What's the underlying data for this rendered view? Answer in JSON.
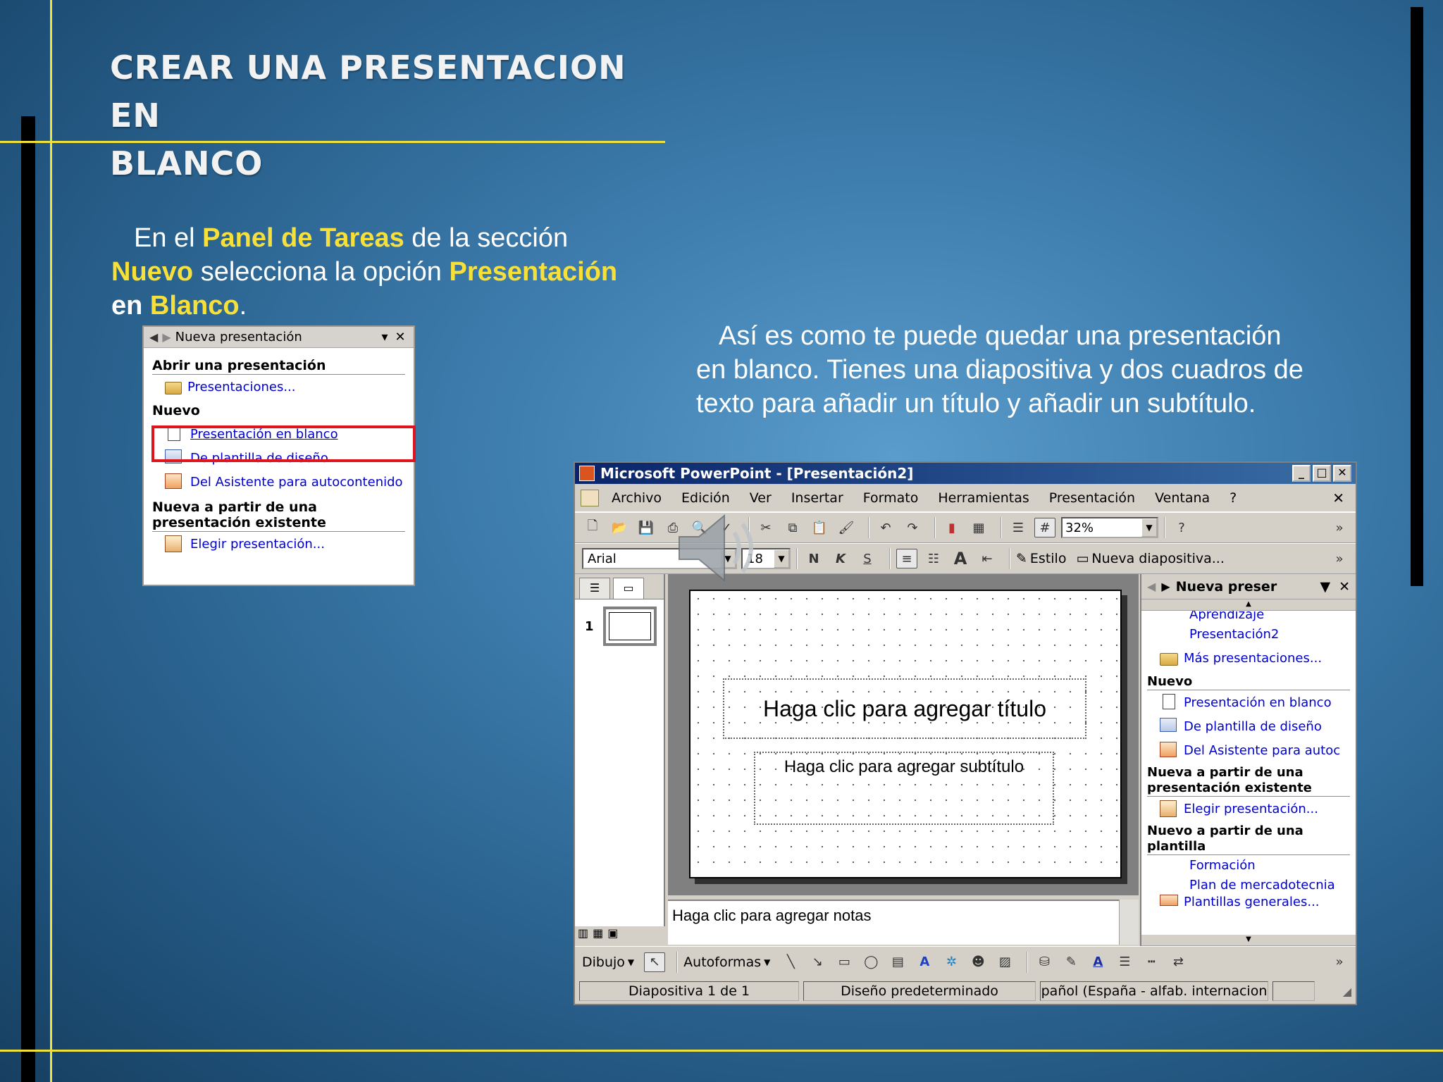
{
  "slide": {
    "title_line1": "CREAR UNA  PRESENTACION EN",
    "title_line2": "BLANCO",
    "instruction": {
      "p1": "En el ",
      "h1": "Panel de Tareas",
      "p2": " de la sección",
      "h2": "Nuevo",
      "p3": " selecciona la opción ",
      "h3": "Presentación",
      "p4": "en ",
      "h4": "Blanco",
      "p5": "."
    },
    "description_line1": "Así es como te puede quedar una presentación",
    "description_line2": "en blanco. Tienes una diapositiva y dos cuadros de",
    "description_line3": "texto para añadir un título y añadir un subtítulo."
  },
  "task_pane": {
    "title": "Nueva presentación",
    "section_open": "Abrir una presentación",
    "link_presentations": "Presentaciones...",
    "section_new": "Nuevo",
    "link_blank": "Presentación en blanco",
    "link_template": "De plantilla de diseño",
    "link_wizard": "Del Asistente para autocontenido",
    "section_existing_1": "Nueva a partir de una",
    "section_existing_2": "presentación existente",
    "link_choose": "Elegir presentación..."
  },
  "ppt": {
    "window_title": "Microsoft PowerPoint - [Presentación2]",
    "menu": [
      "Archivo",
      "Edición",
      "Ver",
      "Insertar",
      "Formato",
      "Herramientas",
      "Presentación",
      "Ventana",
      "?"
    ],
    "zoom": "32%",
    "font": "Arial",
    "font_size": "18",
    "style_label": "Estilo",
    "new_slide_label": "Nueva diapositiva...",
    "slide_number": "1",
    "title_placeholder": "Haga clic para agregar título",
    "subtitle_placeholder": "Haga clic para agregar subtítulo",
    "notes_placeholder": "Haga clic para agregar notas",
    "task_pane": {
      "title": "Nueva preser",
      "item_cut": "Aprendizaje",
      "item_pres2": "Presentación2",
      "item_more": "Más presentaciones...",
      "section_new": "Nuevo",
      "link_blank": "Presentación en blanco",
      "link_template": "De plantilla de diseño",
      "link_wizard": "Del Asistente para autoc",
      "section_existing_1": "Nueva a partir de una",
      "section_existing_2": "presentación existente",
      "link_choose": "Elegir presentación...",
      "section_template_1": "Nuevo a partir de una",
      "section_template_2": "plantilla",
      "link_training": "Formación",
      "link_marketing": "Plan de mercadotecnia",
      "link_general": "Plantillas generales..."
    },
    "draw_label": "Dibujo",
    "autoshapes_label": "Autoformas",
    "status": {
      "slide": "Diapositiva 1 de 1",
      "design": "Diseño predeterminado",
      "language": "pañol (España - alfab. internacion"
    }
  },
  "colors": {
    "highlight_text": "#f7e03a",
    "accent_line": "#f0e23a",
    "selection_box": "#e0141c",
    "titlebar": "#0a246a"
  }
}
